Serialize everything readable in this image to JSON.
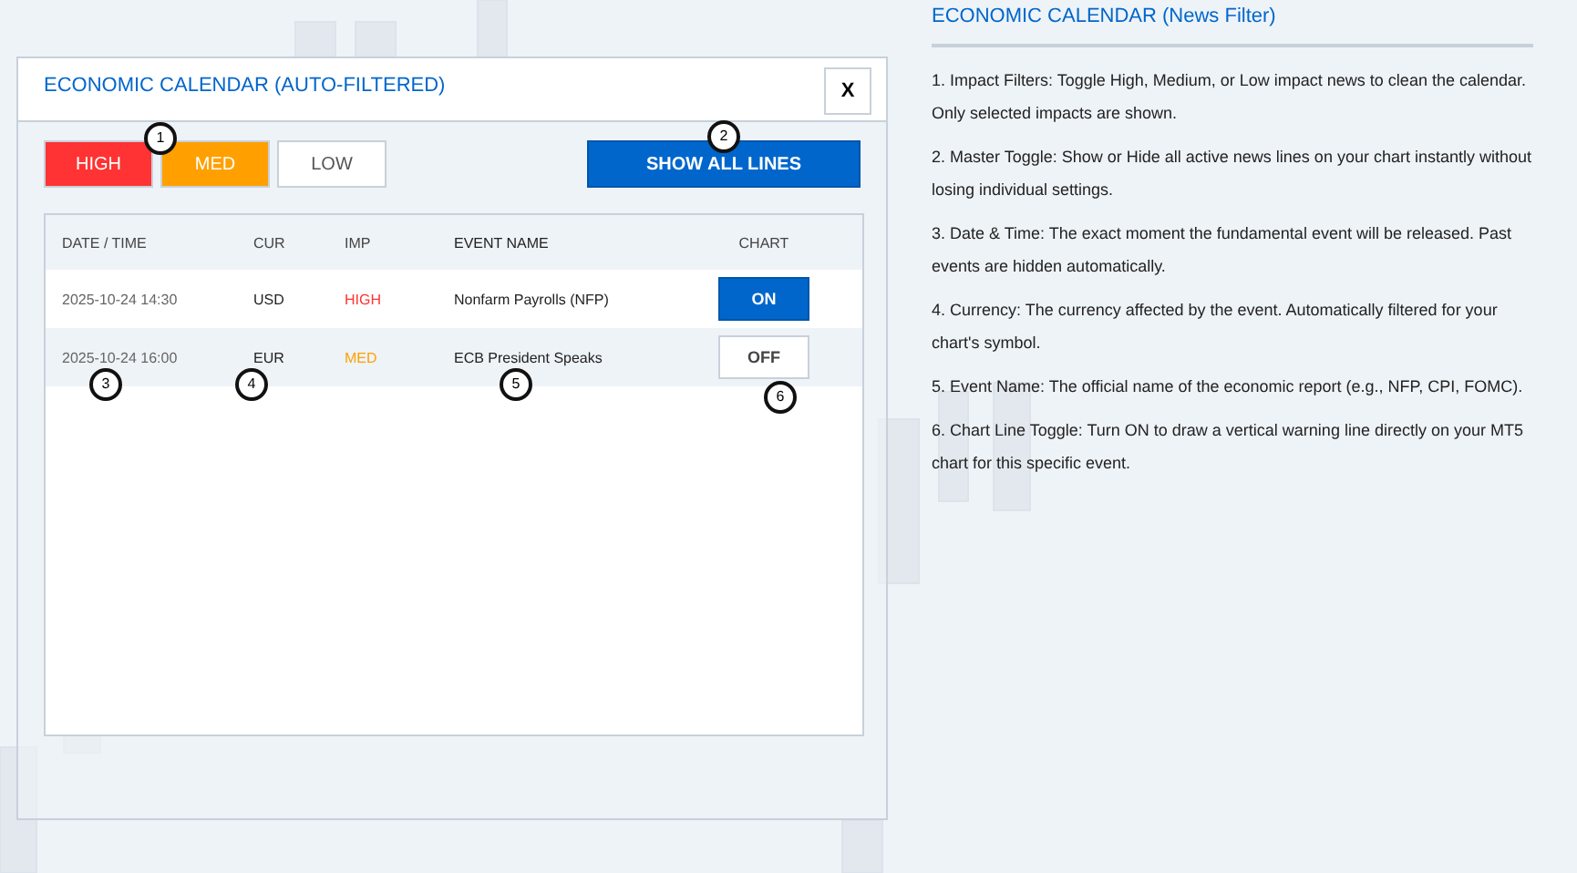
{
  "dialog": {
    "title": "ECONOMIC CALENDAR (AUTO-FILTERED)",
    "close": "X",
    "filters": [
      {
        "label": "HIGH",
        "kind": "high",
        "selected": true
      },
      {
        "label": "MED",
        "kind": "med",
        "selected": true
      },
      {
        "label": "LOW",
        "kind": "low",
        "selected": false
      }
    ],
    "master_button": "SHOW ALL LINES",
    "table": {
      "columns": [
        "DATE / TIME",
        "CUR",
        "IMP",
        "EVENT NAME",
        "CHART"
      ],
      "rows": [
        {
          "date": "2025-10-24 14:30",
          "currency": "USD",
          "impact": {
            "label": "HIGH",
            "kind": "high"
          },
          "event": "Nonfarm Payrolls (NFP)",
          "chart": {
            "label": "ON",
            "on": true
          }
        },
        {
          "date": "2025-10-24 16:00",
          "currency": "EUR",
          "impact": {
            "label": "MED",
            "kind": "med"
          },
          "event": "ECB President Speaks",
          "chart": {
            "label": "OFF",
            "on": false
          }
        }
      ]
    },
    "callouts": [
      "1",
      "2",
      "3",
      "4",
      "5",
      "6"
    ]
  },
  "help": {
    "title": "ECONOMIC CALENDAR (News Filter)",
    "notes": [
      "1. Impact Filters: Toggle High, Medium, or Low impact news to clean the calendar. Only selected impacts are shown.",
      "2. Master Toggle: Show or Hide all active news lines on your chart instantly without losing individual settings.",
      "3. Date & Time: The exact moment the fundamental event will be released. Past events are hidden automatically.",
      "4. Currency: The currency affected by the event. Automatically filtered for your chart's symbol.",
      "5. Event Name: The official name of the economic report (e.g., NFP, CPI, FOMC).",
      "6. Chart Line Toggle: Turn ON to draw a vertical warning line directly on your MT5 chart for this specific event."
    ]
  }
}
